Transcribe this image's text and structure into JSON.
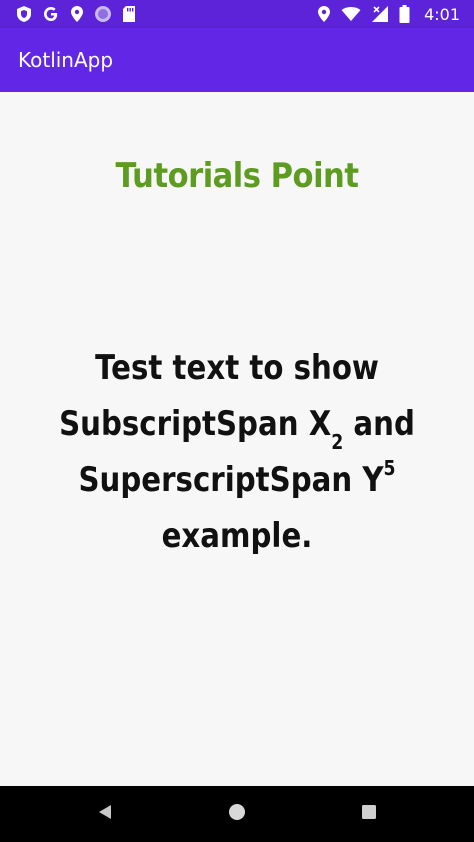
{
  "status_bar": {
    "time": "4:01",
    "left_icons": [
      "shield-icon",
      "google-g-icon",
      "location-pin-icon",
      "circle-app-icon",
      "sd-card-icon"
    ],
    "right_icons": [
      "location-pin-icon",
      "wifi-icon",
      "signal-no-data-icon",
      "battery-icon"
    ]
  },
  "app_bar": {
    "title": "KotlinApp"
  },
  "content": {
    "heading": "Tutorials Point",
    "line1": "Test text to show",
    "line2_pre": "SubscriptSpan X",
    "line2_sub": "2",
    "line2_post": " and",
    "line3_pre": "SuperscriptSpan Y",
    "line3_sup": "5",
    "line4": "example."
  },
  "nav_bar": {
    "buttons": [
      "back-icon",
      "home-icon",
      "recents-icon"
    ]
  },
  "colors": {
    "status_bar": "#5d23d8",
    "app_bar": "#6227e6",
    "heading": "#5e9b21",
    "text": "#111111",
    "background": "#f7f7f7",
    "nav_bar": "#000000"
  }
}
